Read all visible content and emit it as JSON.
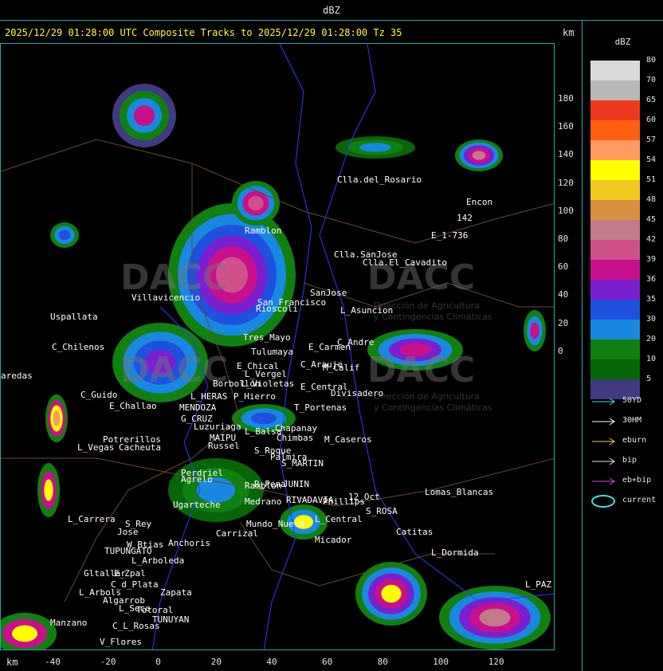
{
  "top_label": "dBZ",
  "headline": "2025/12/29 01:28:00 UTC Composite Tracks to 2025/12/29 01:28:00 Tz 35",
  "distance_unit": "km",
  "legend": {
    "title": "dBZ",
    "levels": [
      {
        "value": "80",
        "color": "#d9d9d9"
      },
      {
        "value": "70",
        "color": "#b8b8b8"
      },
      {
        "value": "65",
        "color": "#ee3a1e"
      },
      {
        "value": "60",
        "color": "#ff6010"
      },
      {
        "value": "57",
        "color": "#ff9a60"
      },
      {
        "value": "54",
        "color": "#ffff00"
      },
      {
        "value": "51",
        "color": "#f2c820"
      },
      {
        "value": "48",
        "color": "#d89040"
      },
      {
        "value": "45",
        "color": "#c07a8a"
      },
      {
        "value": "42",
        "color": "#d0508a"
      },
      {
        "value": "39",
        "color": "#c8108a"
      },
      {
        "value": "36",
        "color": "#7a20d0"
      },
      {
        "value": "35",
        "color": "#2050e0"
      },
      {
        "value": "30",
        "color": "#1888e0"
      },
      {
        "value": "20",
        "color": "#108010"
      },
      {
        "value": "10",
        "color": "#066606"
      },
      {
        "value": "5",
        "color": "#403a80"
      }
    ]
  },
  "tracks": [
    {
      "label": "50YD",
      "color": "#40e0e0"
    },
    {
      "label": "30HM",
      "color": "#ffffff"
    },
    {
      "label": "eburn",
      "color": "#f0c070"
    },
    {
      "label": "bip",
      "color": "#ffd0e0"
    },
    {
      "label": "eb+bip",
      "color": "#e040e0"
    },
    {
      "label": "current",
      "color": "#40e0e0"
    }
  ],
  "y_ticks": [
    "180",
    "160",
    "140",
    "120",
    "100",
    "80",
    "60",
    "40",
    "20",
    "0"
  ],
  "x_ticks": [
    "-40",
    "-20",
    "0",
    "20",
    "40",
    "60",
    "80",
    "100",
    "120"
  ],
  "places": [
    "Clla.del_Rosario",
    "Encon",
    "142",
    "E_1-736",
    "Ramblon",
    "Clla.SanJose",
    "Clla.El_Cavadito",
    "Uspallata",
    "Villavicencio",
    "San_Francisco",
    "SanJose",
    "L_Asuncion",
    "Rioscoli",
    "C_Chilenos",
    "Tres_Mayo",
    "Tulumaya",
    "C_Andre",
    "E_Carmen",
    "aredas",
    "E_Chical",
    "L_Vergel",
    "C_Arauje",
    "M_Calif",
    "L_Violetas",
    "E_Central",
    "Divisadero",
    "C_Guido",
    "L_HERAS",
    "P_Hierro",
    "Borbollon",
    "E_Challao",
    "MENDOZA",
    "T_Portenas",
    "G_CRUZ",
    "Luzuriaga",
    "L_Balsa",
    "Chapanay",
    "Potrerillos",
    "Cacheuta",
    "MAIPU",
    "Russel",
    "Chimbas",
    "M_Caseros",
    "L_Vegas",
    "S_Roque",
    "Palmira",
    "S_MARTIN",
    "Perdriel",
    "Agrelo",
    "R_Pena",
    "JUNIN",
    "Ramblon",
    "Ugarteche",
    "L_Carrera",
    "Medrano",
    "RIVADAVIA",
    "Phillips",
    "12_Oct",
    "Lomas_Blancas",
    "S_Rey",
    "Jose",
    "Carrizal",
    "Mundo_Nuevo",
    "S_ROSA",
    "Catitas",
    "L_Central",
    "Anchoris",
    "W_Btias",
    "TUPUNGATO",
    "Micador",
    "L_Dormida",
    "L_Arboleda",
    "Gltallar",
    "E_Zpal",
    "C_d_Plata",
    "L_Arbols",
    "Zapata",
    "L_PAZ",
    "Algarrob",
    "L_Seco",
    "Totoral",
    "TUNUYAN",
    "Manzano",
    "C_L_Rosas",
    "V_Flores"
  ],
  "watermark": {
    "brand": "DACC",
    "line1": "Dirección de Agricultura",
    "line2": "y Contingencias Climáticas"
  }
}
